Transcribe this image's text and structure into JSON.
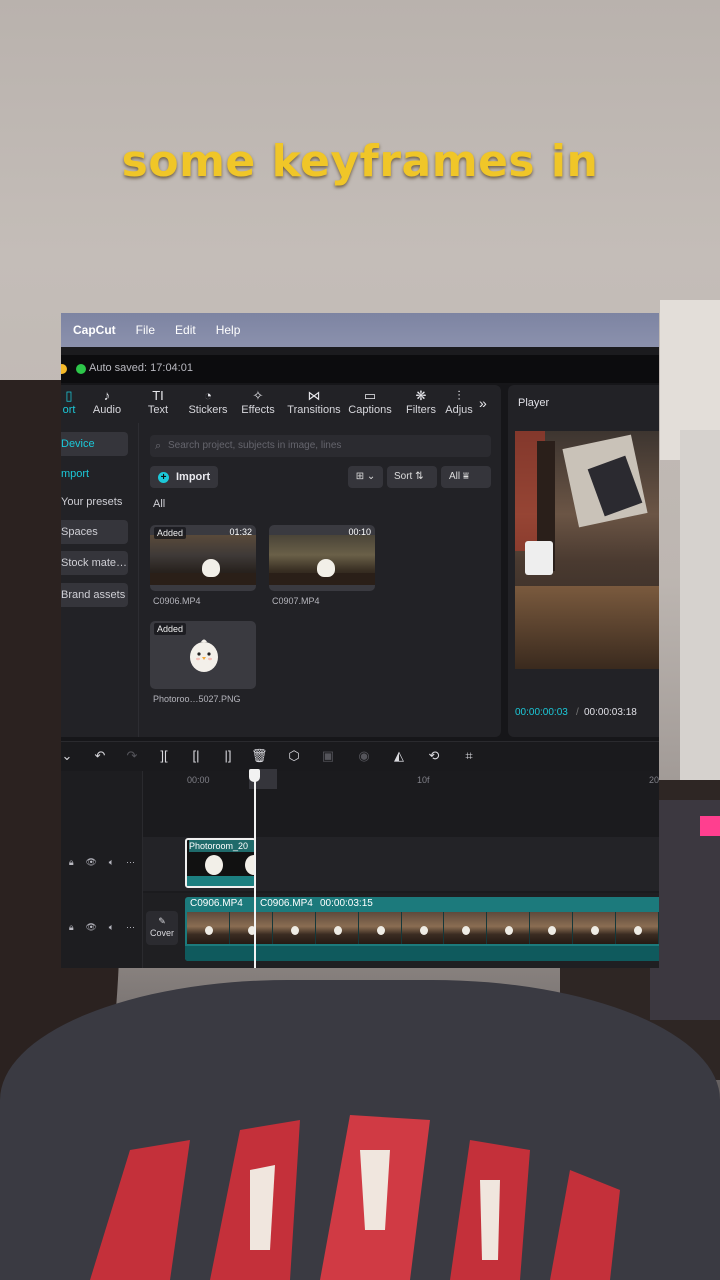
{
  "overlay_caption": "some keyframes in",
  "menubar": {
    "app": "CapCut",
    "items": [
      "File",
      "Edit",
      "Help"
    ]
  },
  "autosave": "Auto saved: 17:04:01",
  "tabs": [
    {
      "label": "ort",
      "icon": "import-icon"
    },
    {
      "label": "Audio",
      "icon": "audio-icon"
    },
    {
      "label": "Text",
      "icon": "text-icon"
    },
    {
      "label": "Stickers",
      "icon": "sticker-icon"
    },
    {
      "label": "Effects",
      "icon": "effects-icon"
    },
    {
      "label": "Transitions",
      "icon": "transitions-icon"
    },
    {
      "label": "Captions",
      "icon": "captions-icon"
    },
    {
      "label": "Filters",
      "icon": "filters-icon"
    },
    {
      "label": "Adjus",
      "icon": "adjust-icon"
    }
  ],
  "sidebar": [
    "Device",
    "mport",
    "Your presets",
    "Spaces",
    "Stock mate…",
    "Brand assets"
  ],
  "search_placeholder": "Search project, subjects in image, lines",
  "import_label": "Import",
  "sort_label": "Sort",
  "filter_all": "All",
  "all_heading": "All",
  "media": [
    {
      "name": "C0906.MP4",
      "tag": "Added",
      "duration": "01:32"
    },
    {
      "name": "C0907.MP4",
      "tag": "",
      "duration": "00:10"
    },
    {
      "name": "Photoroo…5027.PNG",
      "tag": "Added",
      "duration": ""
    }
  ],
  "player": {
    "title": "Player",
    "current": "00:00:00:03",
    "separator": "/",
    "total": "00:00:03:18"
  },
  "ruler": [
    "00:00",
    "10f",
    "20"
  ],
  "overlay_clip": "Photoroom_20",
  "main_clip": {
    "a": "C0906.MP4",
    "b": "C0906.MP4",
    "dur": "00:00:03:15"
  },
  "cover_label": "Cover"
}
